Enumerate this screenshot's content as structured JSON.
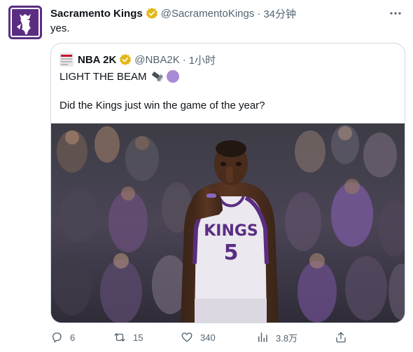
{
  "tweet": {
    "author_name": "Sacramento Kings",
    "author_handle": "@SacramentoKings",
    "separator": "·",
    "time": "34分钟",
    "text": "yes.",
    "avatar_color": "#5a2d82",
    "verified_color": "#e2b719"
  },
  "quote": {
    "author_name": "NBA 2K",
    "author_handle": "@NBA2K",
    "separator": "·",
    "time": "1小时",
    "line1": "LIGHT THE BEAM",
    "line1_emoji": [
      "flashlight-icon",
      "purple-circle-icon"
    ],
    "line2": "Did the Kings just win the game of the year?",
    "jersey_text": "KINGS",
    "jersey_number": "5"
  },
  "actions": {
    "replies": "6",
    "retweets": "15",
    "likes": "340",
    "views": "3.8万"
  },
  "colors": {
    "text": "#0f1419",
    "secondary": "#536471",
    "border": "#cfd9de",
    "kings_purple": "#5a2d82"
  }
}
